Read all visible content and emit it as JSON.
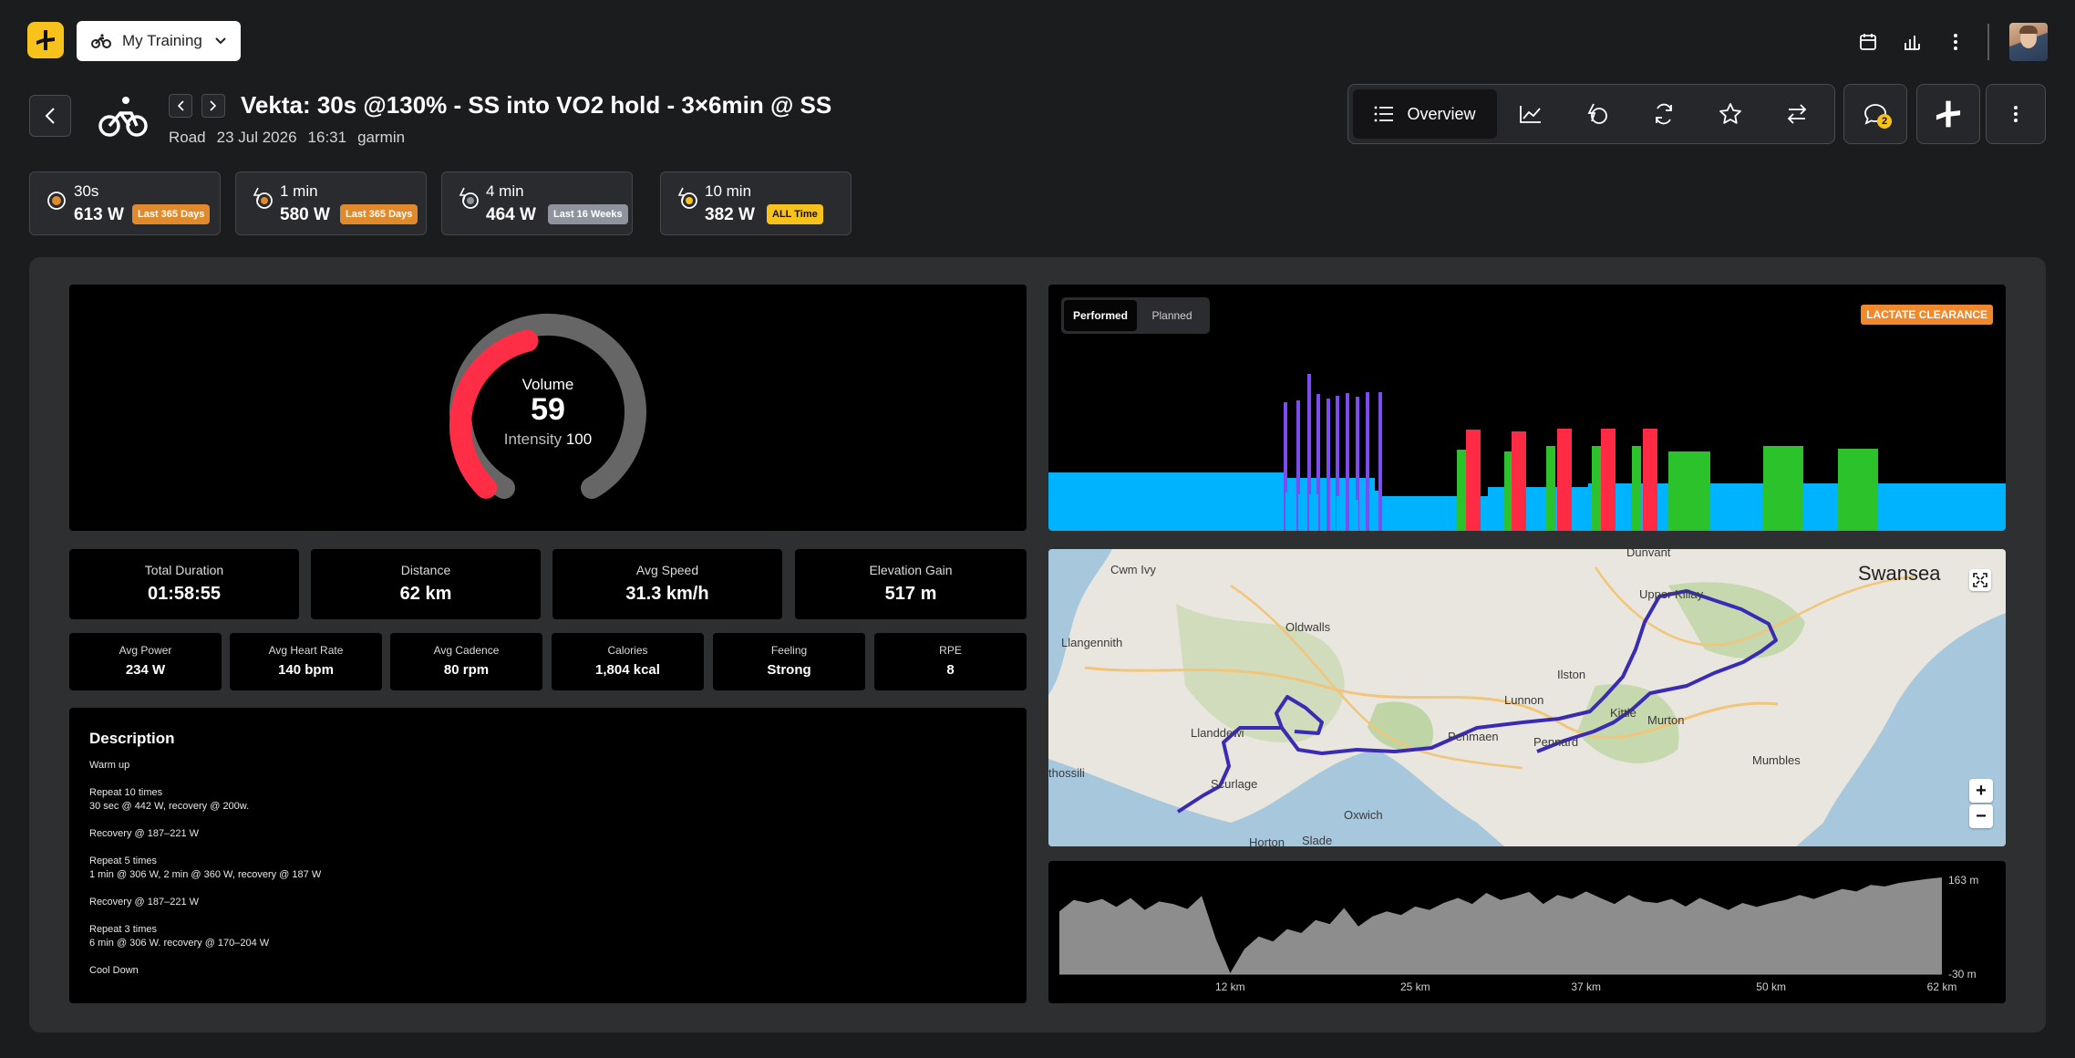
{
  "topbar": {
    "training_select": "My Training",
    "icons": [
      "calendar-icon",
      "bar-chart-icon",
      "kebab-menu-icon"
    ]
  },
  "activity": {
    "title": "Vekta: 30s @130% - SS into VO2 hold - 3×6min @ SS",
    "type": "Road",
    "date": "23 Jul 2026",
    "time": "16:31",
    "source": "garmin"
  },
  "view_tabs": {
    "overview_label": "Overview",
    "notifications_count": "2"
  },
  "power_bests": [
    {
      "duration": "30s",
      "value": "613 W",
      "tag": "Last 365 Days",
      "tag_color": "#e08a2d"
    },
    {
      "duration": "1 min",
      "value": "580 W",
      "tag": "Last 365 Days",
      "tag_color": "#e08a2d"
    },
    {
      "duration": "4 min",
      "value": "464 W",
      "tag": "Last 16 Weeks",
      "tag_color": "#8e939e"
    },
    {
      "duration": "10 min",
      "value": "382 W",
      "tag": "ALL Time",
      "tag_color": "#f6c21b"
    }
  ],
  "gauge": {
    "label": "Volume",
    "volume": "59",
    "intensity_label": "Intensity",
    "intensity": "100",
    "volume_fraction": 0.45,
    "colors": {
      "fill": "#ff2d45",
      "track": "#666666"
    }
  },
  "stats_primary": [
    {
      "label": "Total Duration",
      "value": "01:58:55"
    },
    {
      "label": "Distance",
      "value": "62 km"
    },
    {
      "label": "Avg Speed",
      "value": "31.3 km/h"
    },
    {
      "label": "Elevation Gain",
      "value": "517 m"
    }
  ],
  "stats_secondary": [
    {
      "label": "Avg Power",
      "value": "234 W"
    },
    {
      "label": "Avg Heart Rate",
      "value": "140 bpm"
    },
    {
      "label": "Avg Cadence",
      "value": "80 rpm"
    },
    {
      "label": "Calories",
      "value": "1,804 kcal"
    },
    {
      "label": "Feeling",
      "value": "Strong"
    },
    {
      "label": "RPE",
      "value": "8"
    }
  ],
  "description": {
    "title": "Description",
    "lines": [
      "Warm up",
      "",
      "Repeat 10 times",
      "30 sec @ 442 W, recovery @ 200w.",
      "",
      "Recovery @ 187–221 W",
      "",
      "Repeat 5 times",
      "1 min @ 306 W, 2 min @ 360 W, recovery @ 187 W",
      "",
      "Recovery @ 187–221 W",
      "",
      "Repeat 3 times",
      "6 min @ 306 W. recovery @ 170–204 W",
      "",
      "Cool Down"
    ]
  },
  "workout_chart": {
    "toggle": {
      "performed": "Performed",
      "planned": "Planned"
    },
    "zone_badge": "LACTATE CLEARANCE",
    "colors": {
      "base": "#00b3ff",
      "vo2": "#7d4cf0",
      "red": "#ff2b45",
      "green": "#2cc22c"
    }
  },
  "map": {
    "labels": [
      "Cwm Ivy",
      "Oldwalls",
      "Llangennith",
      "Llanddewi",
      "thossili",
      "Scurlage",
      "Oxwich",
      "Horton",
      "Slade",
      "Penmaen",
      "Lunnon",
      "Ilston",
      "Kittle",
      "Murton",
      "Pennard",
      "Mumbles",
      "Upper Killay",
      "Dunvant",
      "Swansea"
    ],
    "zoom_in": "+",
    "zoom_out": "−"
  },
  "chart_data": {
    "type": "area",
    "title": "",
    "xlabel": "",
    "ylabel": "",
    "x_tick_labels": [
      "12 km",
      "25 km",
      "37 km",
      "50 km",
      "62 km"
    ],
    "y_tick_labels": [
      "163 m",
      "-30 m"
    ],
    "x_ticks": [
      12,
      25,
      37,
      50,
      62
    ],
    "xlim": [
      0,
      62
    ],
    "ylim": [
      -30,
      163
    ],
    "x": [
      0,
      1,
      2,
      3,
      4,
      5,
      6,
      7,
      8,
      9,
      10,
      11,
      12,
      13,
      14,
      15,
      16,
      17,
      18,
      19,
      20,
      21,
      22,
      23,
      24,
      25,
      26,
      27,
      28,
      29,
      30,
      31,
      32,
      33,
      34,
      35,
      36,
      37,
      38,
      39,
      40,
      41,
      42,
      43,
      44,
      45,
      46,
      47,
      48,
      49,
      50,
      51,
      52,
      53,
      54,
      55,
      56,
      57,
      58,
      59,
      60,
      61,
      62
    ],
    "y": [
      95,
      118,
      112,
      120,
      104,
      122,
      98,
      115,
      110,
      100,
      126,
      40,
      -28,
      20,
      45,
      35,
      60,
      52,
      78,
      70,
      102,
      65,
      85,
      95,
      88,
      105,
      98,
      112,
      122,
      110,
      132,
      118,
      125,
      134,
      110,
      128,
      120,
      135,
      122,
      110,
      128,
      115,
      112,
      120,
      105,
      122,
      110,
      98,
      112,
      104,
      112,
      118,
      128,
      120,
      130,
      140,
      135,
      148,
      145,
      152,
      156,
      160,
      163
    ]
  }
}
